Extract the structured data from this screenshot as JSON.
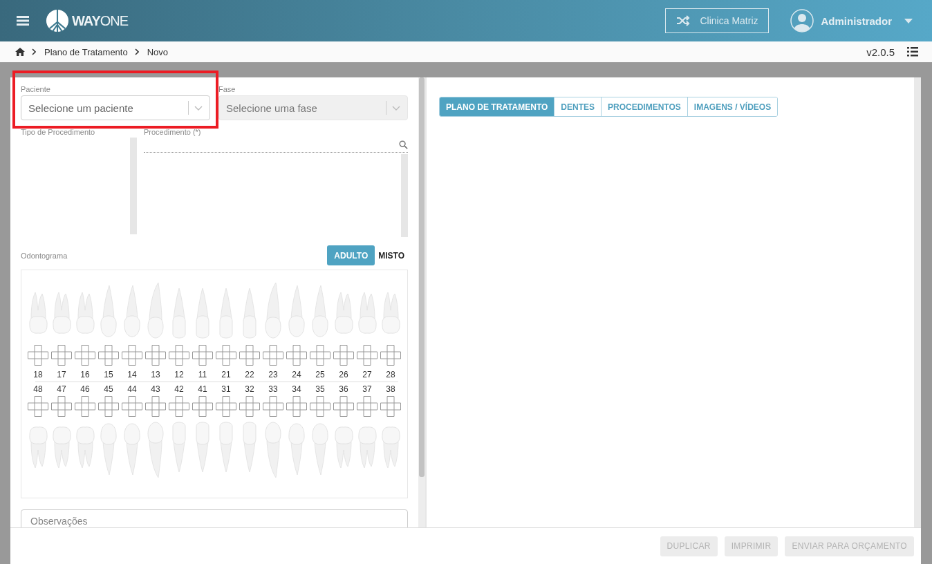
{
  "header": {
    "logo": {
      "strong": "WAY",
      "light": "ONE"
    },
    "clinic_button": "Clinica Matriz",
    "user": "Administrador"
  },
  "breadcrumb": [
    "Plano de Tratamento",
    "Novo"
  ],
  "version": "v2.0.5",
  "fields": [
    {
      "label": "Paciente",
      "placeholder": "Selecione um paciente",
      "disabled": false
    },
    {
      "label": "Fase",
      "placeholder": "Selecione uma fase",
      "disabled": true
    }
  ],
  "procedure_type": {
    "label": "Tipo de Procedimento"
  },
  "procedure": {
    "label": "Procedimento (*)"
  },
  "odontogram": {
    "label": "Odontograma",
    "modes": [
      {
        "label": "ADULTO",
        "selected": true
      },
      {
        "label": "MISTO",
        "selected": false
      }
    ],
    "upper": [
      {
        "number": "18",
        "kind": "molar"
      },
      {
        "number": "17",
        "kind": "molar"
      },
      {
        "number": "16",
        "kind": "molar"
      },
      {
        "number": "15",
        "kind": "premolar"
      },
      {
        "number": "14",
        "kind": "premolar"
      },
      {
        "number": "13",
        "kind": "canine"
      },
      {
        "number": "12",
        "kind": "incisor"
      },
      {
        "number": "11",
        "kind": "incisor"
      },
      {
        "number": "21",
        "kind": "incisor"
      },
      {
        "number": "22",
        "kind": "incisor"
      },
      {
        "number": "23",
        "kind": "canine"
      },
      {
        "number": "24",
        "kind": "premolar"
      },
      {
        "number": "25",
        "kind": "premolar"
      },
      {
        "number": "26",
        "kind": "molar"
      },
      {
        "number": "27",
        "kind": "molar"
      },
      {
        "number": "28",
        "kind": "molar"
      }
    ],
    "lower": [
      {
        "number": "48",
        "kind": "molar"
      },
      {
        "number": "47",
        "kind": "molar"
      },
      {
        "number": "46",
        "kind": "molar"
      },
      {
        "number": "45",
        "kind": "premolar"
      },
      {
        "number": "44",
        "kind": "premolar"
      },
      {
        "number": "43",
        "kind": "canine"
      },
      {
        "number": "42",
        "kind": "incisor"
      },
      {
        "number": "41",
        "kind": "incisor"
      },
      {
        "number": "31",
        "kind": "incisor"
      },
      {
        "number": "32",
        "kind": "incisor"
      },
      {
        "number": "33",
        "kind": "canine"
      },
      {
        "number": "34",
        "kind": "premolar"
      },
      {
        "number": "35",
        "kind": "premolar"
      },
      {
        "number": "36",
        "kind": "molar"
      },
      {
        "number": "37",
        "kind": "molar"
      },
      {
        "number": "38",
        "kind": "molar"
      }
    ]
  },
  "notes": {
    "placeholder": "Observações"
  },
  "tabs": [
    {
      "label": "PLANO DE TRATAMENTO",
      "selected": true
    },
    {
      "label": "DENTES",
      "selected": false
    },
    {
      "label": "PROCEDIMENTOS",
      "selected": false
    },
    {
      "label": "IMAGENS / VÍDEOS",
      "selected": false
    }
  ],
  "footer_buttons": [
    {
      "label": "DUPLICAR",
      "disabled": true
    },
    {
      "label": "IMPRIMIR",
      "disabled": true
    },
    {
      "label": "ENVIAR PARA ORÇAMENTO",
      "disabled": true
    }
  ]
}
